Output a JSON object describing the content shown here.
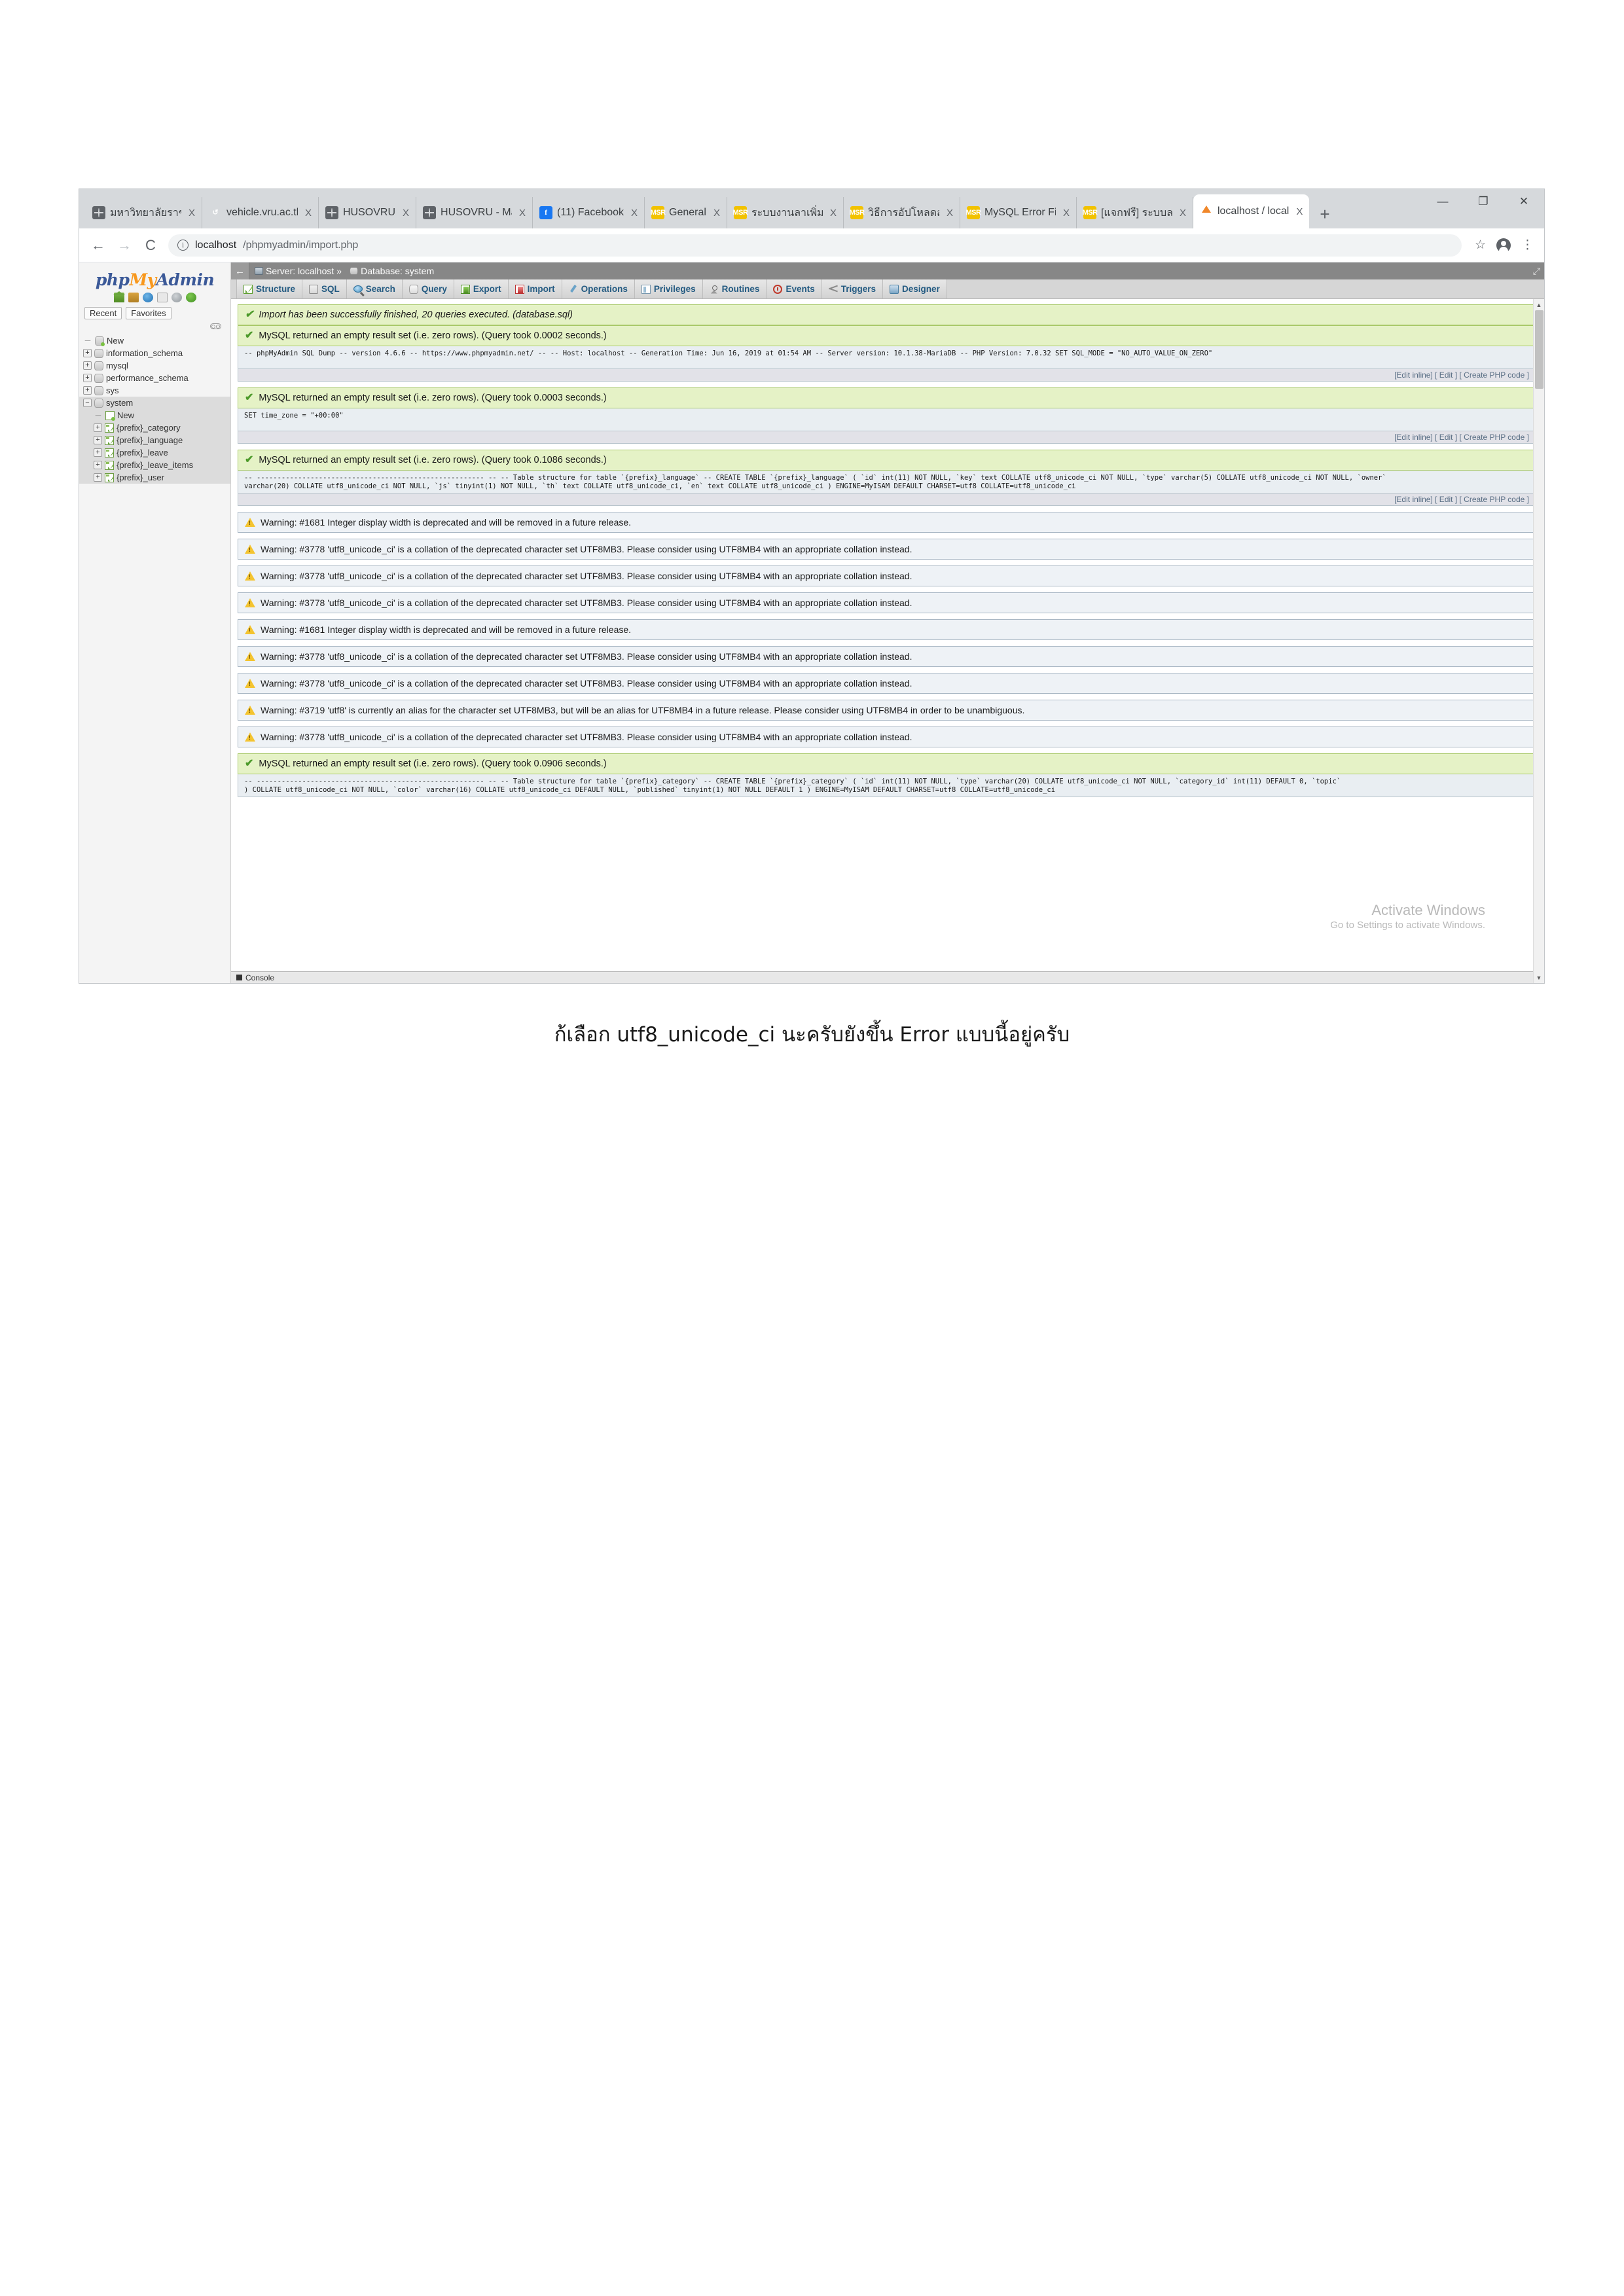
{
  "browser": {
    "tabs": [
      {
        "title": "มหาวิทยาลัยราชภัฏ",
        "favicon": "globe-icon",
        "active": false
      },
      {
        "title": "vehicle.vru.ac.th/",
        "favicon": "spinner-icon",
        "active": false
      },
      {
        "title": "HUSOVRU",
        "favicon": "globe-icon",
        "active": false
      },
      {
        "title": "HUSOVRU - Man",
        "favicon": "globe-icon",
        "active": false
      },
      {
        "title": "(11) Facebook",
        "favicon": "facebook-icon",
        "active": false
      },
      {
        "title": "General",
        "favicon": "msr-icon",
        "active": false
      },
      {
        "title": "ระบบงานลาเพิ่มด่ำ",
        "favicon": "msr-icon",
        "active": false
      },
      {
        "title": "วิธีการอัปโหลดสคริ",
        "favicon": "msr-icon",
        "active": false
      },
      {
        "title": "MySQL Error Fiel",
        "favicon": "msr-icon",
        "active": false
      },
      {
        "title": "[แจกฟรี] ระบบลาง",
        "favicon": "msr-icon",
        "active": false
      },
      {
        "title": "localhost / local",
        "favicon": "phpmyadmin-icon",
        "active": true
      }
    ],
    "new_tab_label": "+",
    "tab_close_label": "X",
    "window_controls": {
      "minimize": "—",
      "maximize": "❐",
      "close": "✕"
    },
    "nav": {
      "back": "←",
      "forward": "→",
      "reload": "C"
    },
    "omnibox": {
      "info": "i",
      "host": "localhost",
      "path": "/phpmyadmin/import.php"
    },
    "toolbar_right": {
      "bookmark": "☆",
      "profile": "profile-avatar",
      "menu": "⋮"
    }
  },
  "phpmyadmin": {
    "logo": {
      "php": "php",
      "my": "My",
      "admin": "Admin"
    },
    "header_icons": [
      "home-icon",
      "exit-icon",
      "help-icon",
      "docs-icon",
      "settings-icon",
      "refresh-icon"
    ],
    "chips": [
      "Recent",
      "Favorites"
    ],
    "tree": [
      {
        "label": "New",
        "level": 0,
        "toggle": "",
        "icon": "db-new-icon",
        "selected": false
      },
      {
        "label": "information_schema",
        "level": 0,
        "toggle": "+",
        "icon": "db-icon",
        "selected": false
      },
      {
        "label": "mysql",
        "level": 0,
        "toggle": "+",
        "icon": "db-icon",
        "selected": false
      },
      {
        "label": "performance_schema",
        "level": 0,
        "toggle": "+",
        "icon": "db-icon",
        "selected": false
      },
      {
        "label": "sys",
        "level": 0,
        "toggle": "+",
        "icon": "db-icon",
        "selected": false
      },
      {
        "label": "system",
        "level": 0,
        "toggle": "−",
        "icon": "db-icon",
        "selected": true
      },
      {
        "label": "New",
        "level": 1,
        "toggle": "",
        "icon": "table-new-icon",
        "selected": true
      },
      {
        "label": "{prefix}_category",
        "level": 1,
        "toggle": "+",
        "icon": "table-icon",
        "selected": true
      },
      {
        "label": "{prefix}_language",
        "level": 1,
        "toggle": "+",
        "icon": "table-icon",
        "selected": true
      },
      {
        "label": "{prefix}_leave",
        "level": 1,
        "toggle": "+",
        "icon": "table-icon",
        "selected": true
      },
      {
        "label": "{prefix}_leave_items",
        "level": 1,
        "toggle": "+",
        "icon": "table-icon",
        "selected": true
      },
      {
        "label": "{prefix}_user",
        "level": 1,
        "toggle": "+",
        "icon": "table-icon",
        "selected": true
      }
    ],
    "breadcrumb": {
      "back": "←",
      "server_label": "Server: localhost",
      "separator": "»",
      "database_label": "Database: system"
    },
    "tabs": [
      {
        "label": "Structure",
        "icon": "structure-icon"
      },
      {
        "label": "SQL",
        "icon": "sql-icon"
      },
      {
        "label": "Search",
        "icon": "search-icon"
      },
      {
        "label": "Query",
        "icon": "query-icon"
      },
      {
        "label": "Export",
        "icon": "export-icon"
      },
      {
        "label": "Import",
        "icon": "import-icon"
      },
      {
        "label": "Operations",
        "icon": "operations-icon"
      },
      {
        "label": "Privileges",
        "icon": "privileges-icon"
      },
      {
        "label": "Routines",
        "icon": "routines-icon"
      },
      {
        "label": "Events",
        "icon": "events-icon"
      },
      {
        "label": "Triggers",
        "icon": "triggers-icon"
      },
      {
        "label": "Designer",
        "icon": "designer-icon"
      }
    ],
    "results": [
      {
        "kind": "success",
        "italic": true,
        "message": "Import has been successfully finished, 20 queries executed. (database.sql)"
      },
      {
        "kind": "success",
        "italic": false,
        "message": "MySQL returned an empty result set (i.e. zero rows). (Query took 0.0002 seconds.)",
        "sql_lines": [
          "-- phpMyAdmin SQL Dump -- version 4.6.6 -- https://www.phpmyadmin.net/ -- -- Host: localhost -- Generation Time: Jun 16, 2019 at 01:54 AM -- Server version: 10.1.38-MariaDB -- PHP Version: 7.0.32 SET SQL_MODE = \"NO_AUTO_VALUE_ON_ZERO\""
        ],
        "actions": [
          "[Edit inline]",
          "[ Edit ]",
          "[ Create PHP code ]"
        ]
      },
      {
        "kind": "success",
        "italic": false,
        "message": "MySQL returned an empty result set (i.e. zero rows). (Query took 0.0003 seconds.)",
        "sql_lines": [
          "SET time_zone = \"+00:00\""
        ],
        "actions": [
          "[Edit inline]",
          "[ Edit ]",
          "[ Create PHP code ]"
        ]
      },
      {
        "kind": "success",
        "italic": false,
        "message": "MySQL returned an empty result set (i.e. zero rows). (Query took 0.1086 seconds.)",
        "sql_lines": [
          "-- ------------------------------------------------------- -- -- Table structure for table `{prefix}_language` -- CREATE TABLE `{prefix}_language` ( `id` int(11) NOT NULL, `key` text COLLATE utf8_unicode_ci NOT NULL, `type` varchar(5) COLLATE utf8_unicode_ci NOT NULL, `owner`",
          "varchar(20) COLLATE utf8_unicode_ci NOT NULL, `js` tinyint(1) NOT NULL, `th` text COLLATE utf8_unicode_ci, `en` text COLLATE utf8_unicode_ci ) ENGINE=MyISAM DEFAULT CHARSET=utf8 COLLATE=utf8_unicode_ci"
        ],
        "actions": [
          "[Edit inline]",
          "[ Edit ]",
          "[ Create PHP code ]"
        ]
      },
      {
        "kind": "warning",
        "message": "Warning: #1681 Integer display width is deprecated and will be removed in a future release."
      },
      {
        "kind": "warning",
        "message": "Warning: #3778 'utf8_unicode_ci' is a collation of the deprecated character set UTF8MB3. Please consider using UTF8MB4 with an appropriate collation instead."
      },
      {
        "kind": "warning",
        "message": "Warning: #3778 'utf8_unicode_ci' is a collation of the deprecated character set UTF8MB3. Please consider using UTF8MB4 with an appropriate collation instead."
      },
      {
        "kind": "warning",
        "message": "Warning: #3778 'utf8_unicode_ci' is a collation of the deprecated character set UTF8MB3. Please consider using UTF8MB4 with an appropriate collation instead."
      },
      {
        "kind": "warning",
        "message": "Warning: #1681 Integer display width is deprecated and will be removed in a future release."
      },
      {
        "kind": "warning",
        "message": "Warning: #3778 'utf8_unicode_ci' is a collation of the deprecated character set UTF8MB3. Please consider using UTF8MB4 with an appropriate collation instead."
      },
      {
        "kind": "warning",
        "message": "Warning: #3778 'utf8_unicode_ci' is a collation of the deprecated character set UTF8MB3. Please consider using UTF8MB4 with an appropriate collation instead."
      },
      {
        "kind": "warning",
        "message": "Warning: #3719 'utf8' is currently an alias for the character set UTF8MB3, but will be an alias for UTF8MB4 in a future release. Please consider using UTF8MB4 in order to be unambiguous."
      },
      {
        "kind": "warning",
        "message": "Warning: #3778 'utf8_unicode_ci' is a collation of the deprecated character set UTF8MB3. Please consider using UTF8MB4 with an appropriate collation instead."
      },
      {
        "kind": "success",
        "italic": false,
        "message": "MySQL returned an empty result set (i.e. zero rows). (Query took 0.0906 seconds.)",
        "sql_lines": [
          "-- ------------------------------------------------------- -- -- Table structure for table `{prefix}_category` -- CREATE TABLE `{prefix}_category` ( `id` int(11) NOT NULL, `type` varchar(20) COLLATE utf8_unicode_ci NOT NULL, `category_id` int(11) DEFAULT 0, `topic`",
          ") COLLATE utf8_unicode_ci NOT NULL, `color` varchar(16) COLLATE utf8_unicode_ci DEFAULT NULL, `published` tinyint(1) NOT NULL DEFAULT 1 ) ENGINE=MyISAM DEFAULT CHARSET=utf8 COLLATE=utf8_unicode_ci"
        ]
      }
    ],
    "console_label": "Console",
    "scrollbar": {
      "up": "▲",
      "down": "▼"
    }
  },
  "watermark": {
    "line1": "Activate Windows",
    "line2": "Go to Settings to activate Windows."
  },
  "caption": "ก้เลือก utf8_unicode_ci นะครับยังขึ้น Error แบบนี้อยู่ครับ"
}
